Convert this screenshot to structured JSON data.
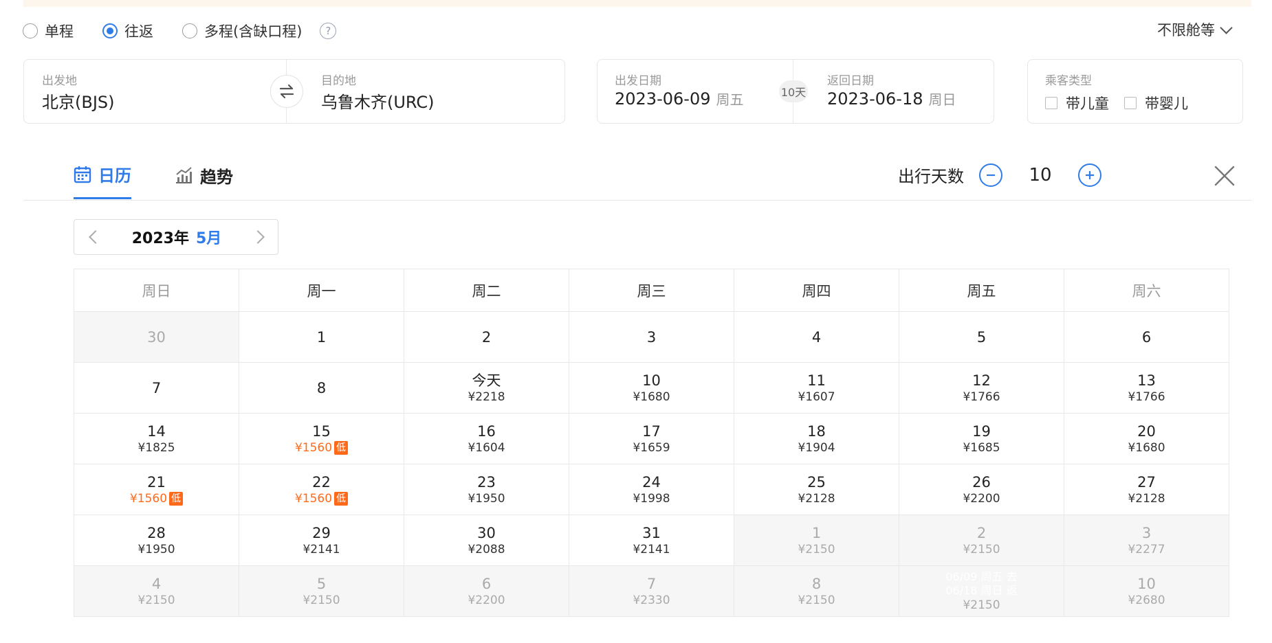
{
  "trip_types": [
    {
      "label": "单程",
      "checked": false
    },
    {
      "label": "往返",
      "checked": true
    },
    {
      "label": "多程(含缺口程)",
      "checked": false
    }
  ],
  "cabin": "不限舱等",
  "origin": {
    "label": "出发地",
    "value": "北京(BJS)"
  },
  "destination": {
    "label": "目的地",
    "value": "乌鲁木齐(URC)"
  },
  "depart": {
    "label": "出发日期",
    "date": "2023-06-09",
    "weekday": "周五"
  },
  "return": {
    "label": "返回日期",
    "date": "2023-06-18",
    "weekday": "周日"
  },
  "duration_badge": "10天",
  "passengers": {
    "label": "乘客类型",
    "child": "带儿童",
    "infant": "带婴儿"
  },
  "tabs": [
    {
      "label": "日历",
      "icon": "calendar-icon",
      "active": true
    },
    {
      "label": "趋势",
      "icon": "trend-chart-icon",
      "active": false
    }
  ],
  "trip_days": {
    "label": "出行天数",
    "value": "10"
  },
  "month_nav": {
    "year": "2023年",
    "month": "5月"
  },
  "weekdays": [
    "周日",
    "周一",
    "周二",
    "周三",
    "周四",
    "周五",
    "周六"
  ],
  "weeks": [
    [
      {
        "day": "30",
        "price": "",
        "state": "grey"
      },
      {
        "day": "1",
        "price": "",
        "state": "normal"
      },
      {
        "day": "2",
        "price": "",
        "state": "normal"
      },
      {
        "day": "3",
        "price": "",
        "state": "normal"
      },
      {
        "day": "4",
        "price": "",
        "state": "normal"
      },
      {
        "day": "5",
        "price": "",
        "state": "normal"
      },
      {
        "day": "6",
        "price": "",
        "state": "normal"
      }
    ],
    [
      {
        "day": "7",
        "price": "",
        "state": "normal"
      },
      {
        "day": "8",
        "price": "",
        "state": "normal"
      },
      {
        "day": "今天",
        "price": "¥2218",
        "state": "normal"
      },
      {
        "day": "10",
        "price": "¥1680",
        "state": "normal"
      },
      {
        "day": "11",
        "price": "¥1607",
        "state": "normal"
      },
      {
        "day": "12",
        "price": "¥1766",
        "state": "normal"
      },
      {
        "day": "13",
        "price": "¥1766",
        "state": "normal"
      }
    ],
    [
      {
        "day": "14",
        "price": "¥1825",
        "state": "normal"
      },
      {
        "day": "15",
        "price": "¥1560",
        "state": "low",
        "tag": "低"
      },
      {
        "day": "16",
        "price": "¥1604",
        "state": "normal"
      },
      {
        "day": "17",
        "price": "¥1659",
        "state": "normal"
      },
      {
        "day": "18",
        "price": "¥1904",
        "state": "normal"
      },
      {
        "day": "19",
        "price": "¥1685",
        "state": "normal"
      },
      {
        "day": "20",
        "price": "¥1680",
        "state": "normal"
      }
    ],
    [
      {
        "day": "21",
        "price": "¥1560",
        "state": "low",
        "tag": "低"
      },
      {
        "day": "22",
        "price": "¥1560",
        "state": "low",
        "tag": "低"
      },
      {
        "day": "23",
        "price": "¥1950",
        "state": "normal"
      },
      {
        "day": "24",
        "price": "¥1998",
        "state": "normal"
      },
      {
        "day": "25",
        "price": "¥2128",
        "state": "normal"
      },
      {
        "day": "26",
        "price": "¥2200",
        "state": "normal"
      },
      {
        "day": "27",
        "price": "¥2128",
        "state": "normal"
      }
    ],
    [
      {
        "day": "28",
        "price": "¥1950",
        "state": "normal"
      },
      {
        "day": "29",
        "price": "¥2141",
        "state": "normal"
      },
      {
        "day": "30",
        "price": "¥2088",
        "state": "normal"
      },
      {
        "day": "31",
        "price": "¥2141",
        "state": "normal"
      },
      {
        "day": "1",
        "price": "¥2150",
        "state": "grey"
      },
      {
        "day": "2",
        "price": "¥2150",
        "state": "grey"
      },
      {
        "day": "3",
        "price": "¥2277",
        "state": "grey"
      }
    ],
    [
      {
        "day": "4",
        "price": "¥2150",
        "state": "grey"
      },
      {
        "day": "5",
        "price": "¥2150",
        "state": "grey"
      },
      {
        "day": "6",
        "price": "¥2200",
        "state": "grey"
      },
      {
        "day": "7",
        "price": "¥2330",
        "state": "grey"
      },
      {
        "day": "8",
        "price": "¥2150",
        "state": "grey"
      },
      {
        "day": "",
        "price": "¥2150",
        "state": "selected",
        "note1": "06/09 周五 去",
        "note2": "06/18 周日 返"
      },
      {
        "day": "10",
        "price": "¥2680",
        "state": "grey"
      }
    ]
  ],
  "colors": {
    "accent": "#2f7bea",
    "low_price": "#ff6a1a",
    "banner": "#fdf6ec"
  }
}
